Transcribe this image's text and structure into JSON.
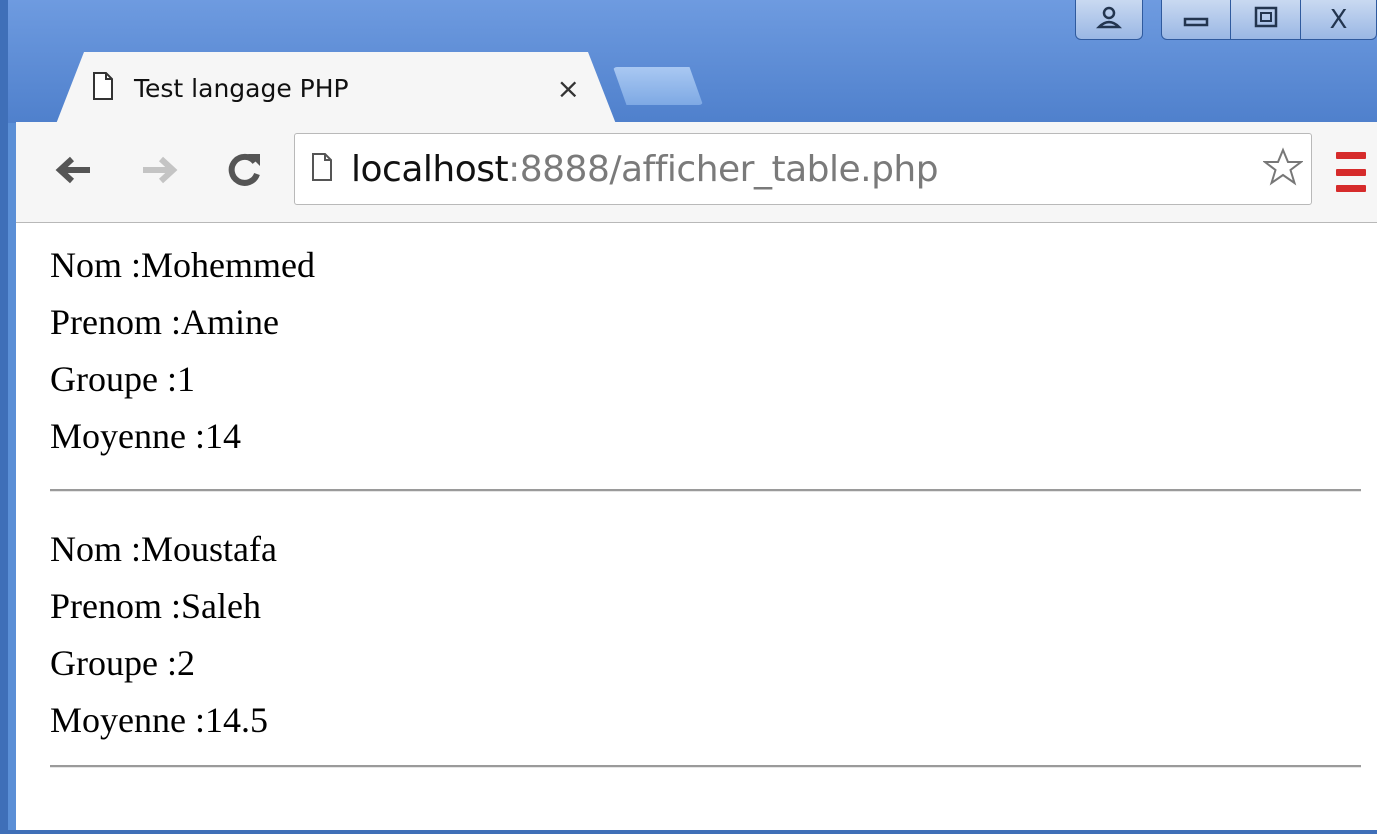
{
  "window": {
    "colors": {
      "frame": "#5b8fd6",
      "menu_accent": "#d62b2b"
    }
  },
  "tab": {
    "title": "Test langage PHP",
    "close_glyph": "×",
    "icon": "page-icon"
  },
  "window_controls": {
    "user_icon": "user-icon",
    "minimize_icon": "minimize-icon",
    "maximize_icon": "maximize-icon",
    "close_glyph": "X"
  },
  "toolbar": {
    "back_icon": "back-arrow-icon",
    "forward_icon": "forward-arrow-icon",
    "reload_icon": "reload-icon",
    "star_icon": "star-icon",
    "menu_icon": "menu-icon"
  },
  "address_bar": {
    "host": "localhost",
    "rest": ":8888/afficher_table.php"
  },
  "records": [
    {
      "nom": "Nom :Mohemmed",
      "prenom": "Prenom :Amine",
      "groupe": "Groupe :1",
      "moyenne": "Moyenne :14"
    },
    {
      "nom": "Nom :Moustafa",
      "prenom": "Prenom :Saleh",
      "groupe": "Groupe :2",
      "moyenne": "Moyenne :14.5"
    }
  ]
}
